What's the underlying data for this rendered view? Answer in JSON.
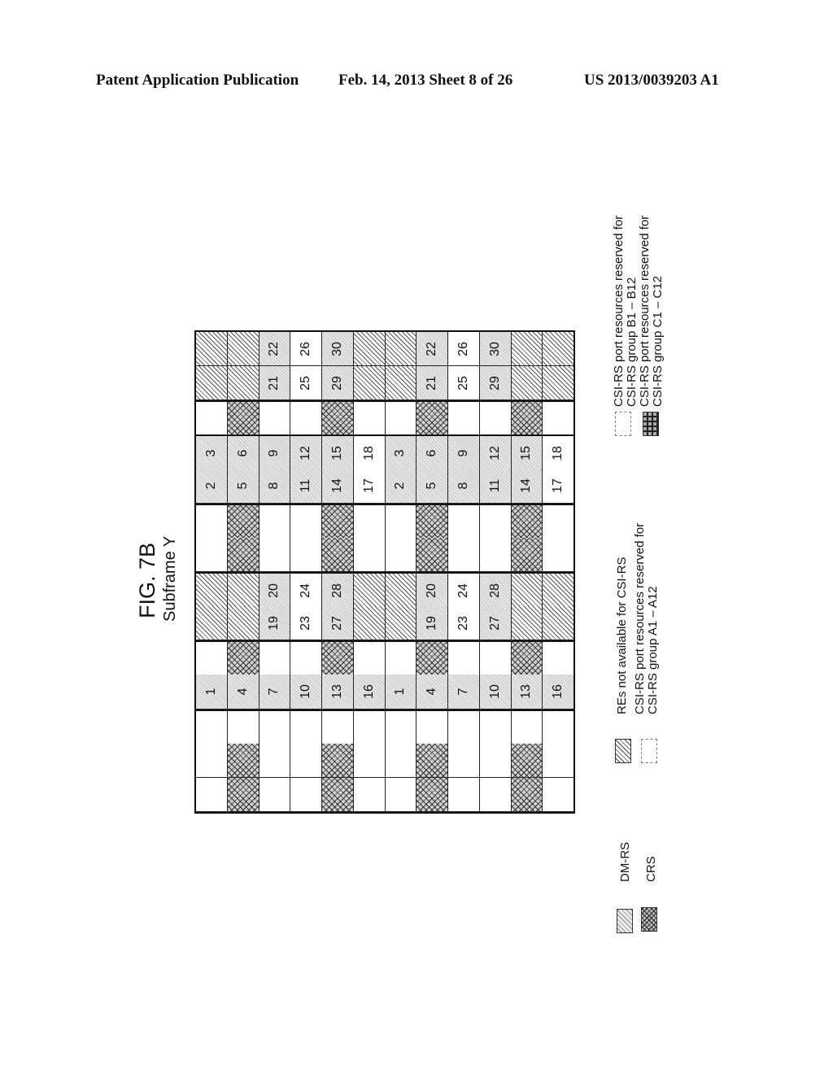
{
  "header": {
    "left": "Patent Application Publication",
    "center": "Feb. 14, 2013   Sheet 8 of 26",
    "right": "US 2013/0039203 A1"
  },
  "figure": {
    "title": "FIG. 7B",
    "subtitle": "Subframe Y"
  },
  "grid": {
    "columns": 12,
    "strips": [
      {
        "sep": false,
        "cells": [
          [
            "hatch",
            ""
          ],
          [
            "hatch",
            ""
          ],
          [
            "shade",
            "22"
          ],
          [
            "blank",
            "26"
          ],
          [
            "shade",
            "30"
          ],
          [
            "hatch",
            ""
          ],
          [
            "hatch",
            ""
          ],
          [
            "shade",
            "22"
          ],
          [
            "blank",
            "26"
          ],
          [
            "shade",
            "30"
          ],
          [
            "hatch",
            ""
          ],
          [
            "hatch",
            ""
          ]
        ]
      },
      {
        "sep": false,
        "cells": [
          [
            "hatch",
            ""
          ],
          [
            "hatch",
            ""
          ],
          [
            "shade",
            "21"
          ],
          [
            "blank",
            "25"
          ],
          [
            "shade",
            "29"
          ],
          [
            "hatch",
            ""
          ],
          [
            "hatch",
            ""
          ],
          [
            "shade",
            "21"
          ],
          [
            "blank",
            "25"
          ],
          [
            "shade",
            "29"
          ],
          [
            "hatch",
            ""
          ],
          [
            "hatch",
            ""
          ]
        ]
      },
      {
        "sep": true,
        "cells": [
          [
            "blank",
            ""
          ],
          [
            "crs",
            ""
          ],
          [
            "blank",
            ""
          ],
          [
            "blank",
            ""
          ],
          [
            "crs",
            ""
          ],
          [
            "blank",
            ""
          ],
          [
            "blank",
            ""
          ],
          [
            "crs",
            ""
          ],
          [
            "blank",
            ""
          ],
          [
            "blank",
            ""
          ],
          [
            "crs",
            ""
          ],
          [
            "blank",
            ""
          ]
        ]
      },
      {
        "sep": true,
        "cells": [
          [
            "shade",
            "3"
          ],
          [
            "shade",
            "6"
          ],
          [
            "shade",
            "9"
          ],
          [
            "shade",
            "12"
          ],
          [
            "shade",
            "15"
          ],
          [
            "blank",
            "18"
          ],
          [
            "shade",
            "3"
          ],
          [
            "shade",
            "6"
          ],
          [
            "shade",
            "9"
          ],
          [
            "shade",
            "12"
          ],
          [
            "shade",
            "15"
          ],
          [
            "blank",
            "18"
          ]
        ]
      },
      {
        "sep": false,
        "cells": [
          [
            "shade",
            "2"
          ],
          [
            "shade",
            "5"
          ],
          [
            "shade",
            "8"
          ],
          [
            "shade",
            "11"
          ],
          [
            "shade",
            "14"
          ],
          [
            "blank",
            "17"
          ],
          [
            "shade",
            "2"
          ],
          [
            "shade",
            "5"
          ],
          [
            "shade",
            "8"
          ],
          [
            "shade",
            "11"
          ],
          [
            "shade",
            "14"
          ],
          [
            "blank",
            "17"
          ]
        ]
      },
      {
        "sep": true,
        "cells": [
          [
            "blank",
            ""
          ],
          [
            "crs",
            ""
          ],
          [
            "blank",
            ""
          ],
          [
            "blank",
            ""
          ],
          [
            "crs",
            ""
          ],
          [
            "blank",
            ""
          ],
          [
            "blank",
            ""
          ],
          [
            "crs",
            ""
          ],
          [
            "blank",
            ""
          ],
          [
            "blank",
            ""
          ],
          [
            "crs",
            ""
          ],
          [
            "blank",
            ""
          ]
        ]
      },
      {
        "sep": false,
        "cells": [
          [
            "blank",
            ""
          ],
          [
            "crs",
            ""
          ],
          [
            "blank",
            ""
          ],
          [
            "blank",
            ""
          ],
          [
            "crs",
            ""
          ],
          [
            "blank",
            ""
          ],
          [
            "blank",
            ""
          ],
          [
            "crs",
            ""
          ],
          [
            "blank",
            ""
          ],
          [
            "blank",
            ""
          ],
          [
            "crs",
            ""
          ],
          [
            "blank",
            ""
          ]
        ]
      },
      {
        "sep": true,
        "cells": [
          [
            "hatch",
            ""
          ],
          [
            "hatch",
            ""
          ],
          [
            "shade",
            "20"
          ],
          [
            "blank",
            "24"
          ],
          [
            "shade",
            "28"
          ],
          [
            "hatch",
            ""
          ],
          [
            "hatch",
            ""
          ],
          [
            "shade",
            "20"
          ],
          [
            "blank",
            "24"
          ],
          [
            "shade",
            "28"
          ],
          [
            "hatch",
            ""
          ],
          [
            "hatch",
            ""
          ]
        ]
      },
      {
        "sep": false,
        "cells": [
          [
            "hatch",
            ""
          ],
          [
            "hatch",
            ""
          ],
          [
            "shade",
            "19"
          ],
          [
            "blank",
            "23"
          ],
          [
            "shade",
            "27"
          ],
          [
            "hatch",
            ""
          ],
          [
            "hatch",
            ""
          ],
          [
            "shade",
            "19"
          ],
          [
            "blank",
            "23"
          ],
          [
            "shade",
            "27"
          ],
          [
            "hatch",
            ""
          ],
          [
            "hatch",
            ""
          ]
        ]
      },
      {
        "sep": true,
        "cells": [
          [
            "blank",
            ""
          ],
          [
            "crs",
            ""
          ],
          [
            "blank",
            ""
          ],
          [
            "blank",
            ""
          ],
          [
            "crs",
            ""
          ],
          [
            "blank",
            ""
          ],
          [
            "blank",
            ""
          ],
          [
            "crs",
            ""
          ],
          [
            "blank",
            ""
          ],
          [
            "blank",
            ""
          ],
          [
            "crs",
            ""
          ],
          [
            "blank",
            ""
          ]
        ]
      },
      {
        "sep": false,
        "cells": [
          [
            "shade",
            "1"
          ],
          [
            "shade",
            "4"
          ],
          [
            "shade",
            "7"
          ],
          [
            "shade",
            "10"
          ],
          [
            "shade",
            "13"
          ],
          [
            "shade",
            "16"
          ],
          [
            "shade",
            "1"
          ],
          [
            "shade",
            "4"
          ],
          [
            "shade",
            "7"
          ],
          [
            "shade",
            "10"
          ],
          [
            "shade",
            "13"
          ],
          [
            "shade",
            "16"
          ]
        ]
      },
      {
        "sep": true,
        "cells": [
          [
            "blank",
            ""
          ],
          [
            "blank",
            ""
          ],
          [
            "blank",
            ""
          ],
          [
            "blank",
            ""
          ],
          [
            "blank",
            ""
          ],
          [
            "blank",
            ""
          ],
          [
            "blank",
            ""
          ],
          [
            "blank",
            ""
          ],
          [
            "blank",
            ""
          ],
          [
            "blank",
            ""
          ],
          [
            "blank",
            ""
          ],
          [
            "blank",
            ""
          ]
        ]
      },
      {
        "sep": false,
        "cells": [
          [
            "blank",
            ""
          ],
          [
            "crs",
            ""
          ],
          [
            "blank",
            ""
          ],
          [
            "blank",
            ""
          ],
          [
            "crs",
            ""
          ],
          [
            "blank",
            ""
          ],
          [
            "blank",
            ""
          ],
          [
            "crs",
            ""
          ],
          [
            "blank",
            ""
          ],
          [
            "blank",
            ""
          ],
          [
            "crs",
            ""
          ],
          [
            "blank",
            ""
          ]
        ]
      },
      {
        "sep": false,
        "cells": [
          [
            "blank",
            ""
          ],
          [
            "crs",
            ""
          ],
          [
            "blank",
            ""
          ],
          [
            "blank",
            ""
          ],
          [
            "crs",
            ""
          ],
          [
            "blank",
            ""
          ],
          [
            "blank",
            ""
          ],
          [
            "crs",
            ""
          ],
          [
            "blank",
            ""
          ],
          [
            "blank",
            ""
          ],
          [
            "crs",
            ""
          ],
          [
            "blank",
            ""
          ]
        ]
      }
    ]
  },
  "legend": {
    "b_group_line1": "CSI-RS port resources reserved for",
    "b_group_line2": "CSI-RS group B1 – B12",
    "c_group_line1": "CSI-RS port resources reserved for",
    "c_group_line2": "CSI-RS group C1 – C12",
    "not_available": "REs not available for CSI-RS",
    "a_group_line1": "CSI-RS port resources reserved for",
    "a_group_line2": "CSI-RS group A1 – A12",
    "dmrs": "DM-RS",
    "crs": "CRS"
  }
}
